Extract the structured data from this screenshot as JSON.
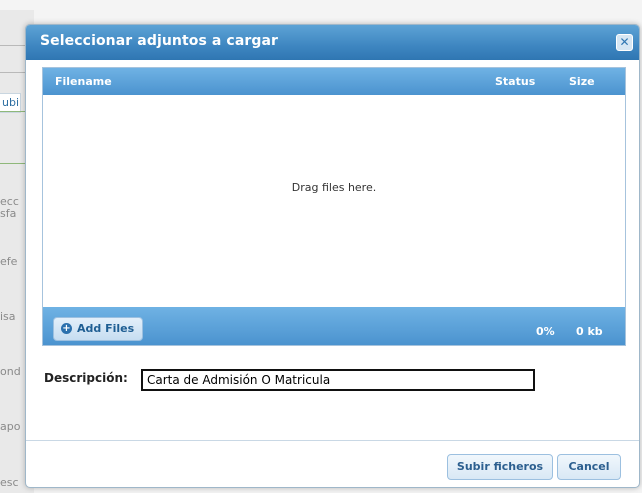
{
  "background": {
    "fragments": [
      "ubi",
      "ecc",
      "sfa",
      "efe",
      "isa",
      "ond",
      "apo",
      "esc"
    ]
  },
  "dialog": {
    "title": "Seleccionar adjuntos a cargar",
    "close_icon": "close-icon",
    "uploader": {
      "columns": [
        "Filename",
        "Status",
        "Size"
      ],
      "drop_message": "Drag files here.",
      "add_files_label": "Add Files",
      "add_icon": "plus-circle-icon",
      "percent": "0%",
      "total_size": "0 kb"
    },
    "description": {
      "label": "Descripción:",
      "value": "Carta de Admisión O Matricula"
    },
    "buttons": {
      "submit": "Subir ficheros",
      "cancel": "Cancel"
    }
  }
}
